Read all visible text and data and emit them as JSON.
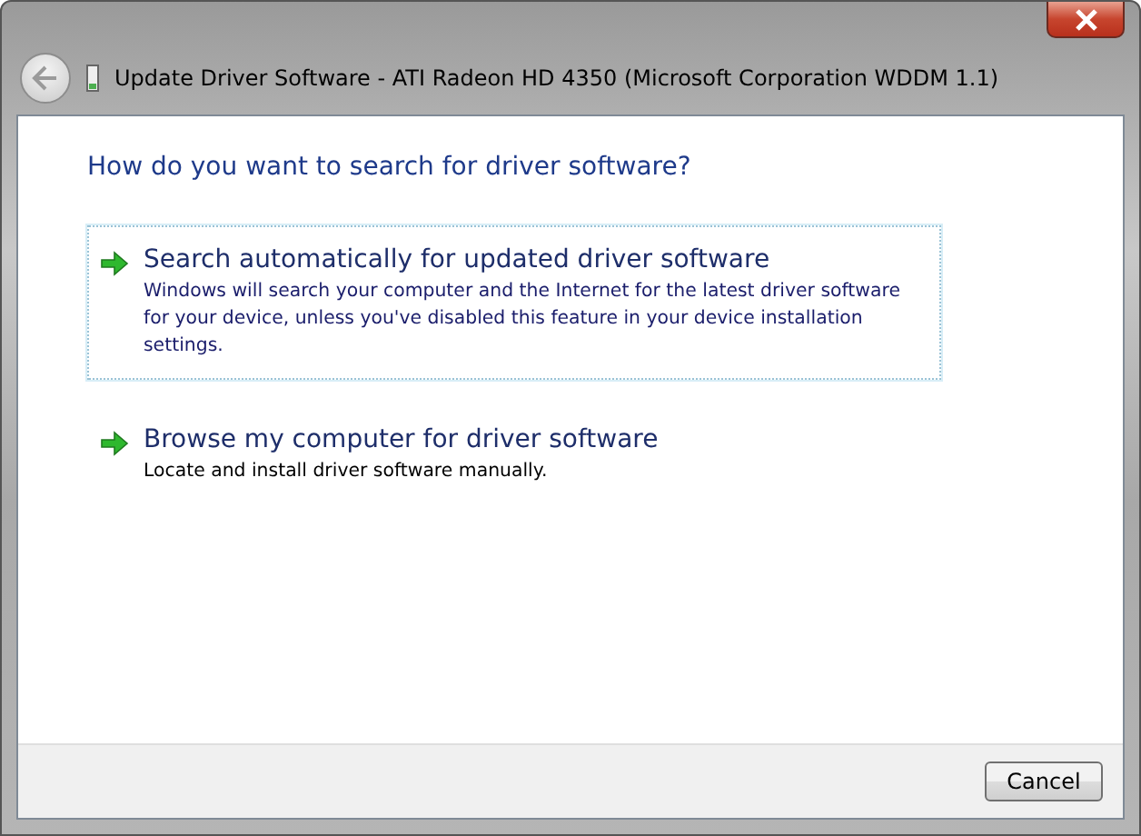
{
  "window": {
    "title": "Update Driver Software - ATI Radeon HD 4350 (Microsoft Corporation WDDM 1.1)"
  },
  "heading": "How do you want to search for driver software?",
  "options": [
    {
      "title": "Search automatically for updated driver software",
      "description": "Windows will search your computer and the Internet for the latest driver software for your device, unless you've disabled this feature in your device installation settings.",
      "focused": true
    },
    {
      "title": "Browse my computer for driver software",
      "description": "Locate and install driver software manually.",
      "focused": false
    }
  ],
  "buttons": [
    "Cancel"
  ]
}
